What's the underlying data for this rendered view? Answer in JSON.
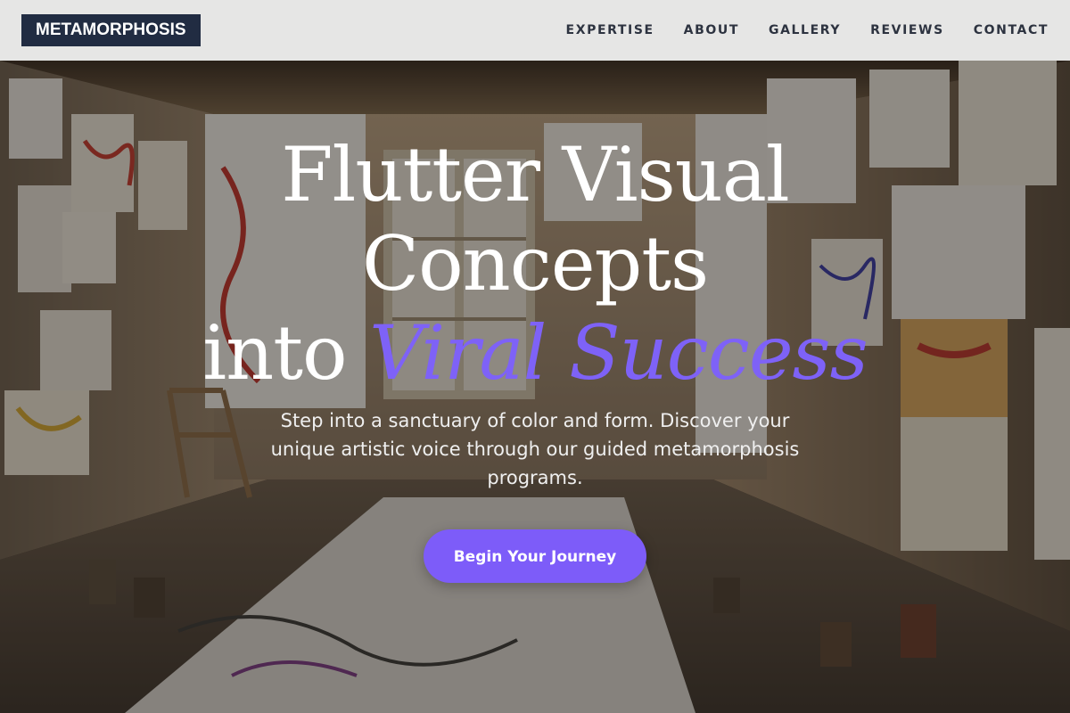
{
  "brand": {
    "logo_text": "METAMORPHOSIS"
  },
  "nav": {
    "items": [
      {
        "label": "EXPERTISE"
      },
      {
        "label": "ABOUT"
      },
      {
        "label": "GALLERY"
      },
      {
        "label": "REVIEWS"
      },
      {
        "label": "CONTACT"
      }
    ]
  },
  "hero": {
    "headline_line1": "Flutter Visual",
    "headline_line2": "Concepts",
    "headline_line3_plain": "into ",
    "headline_line3_accent": "Viral Success",
    "subtitle": "Step into a sanctuary of color and form. Discover your unique artistic voice through our guided metamorphosis programs.",
    "cta_label": "Begin Your Journey",
    "background_image_icon": "art-studio-photo"
  },
  "colors": {
    "header_bg": "#e6e6e5",
    "logo_bg": "#212c42",
    "nav_text": "#2d3340",
    "accent": "#7d5cf9",
    "headline_text": "#ffffff"
  }
}
